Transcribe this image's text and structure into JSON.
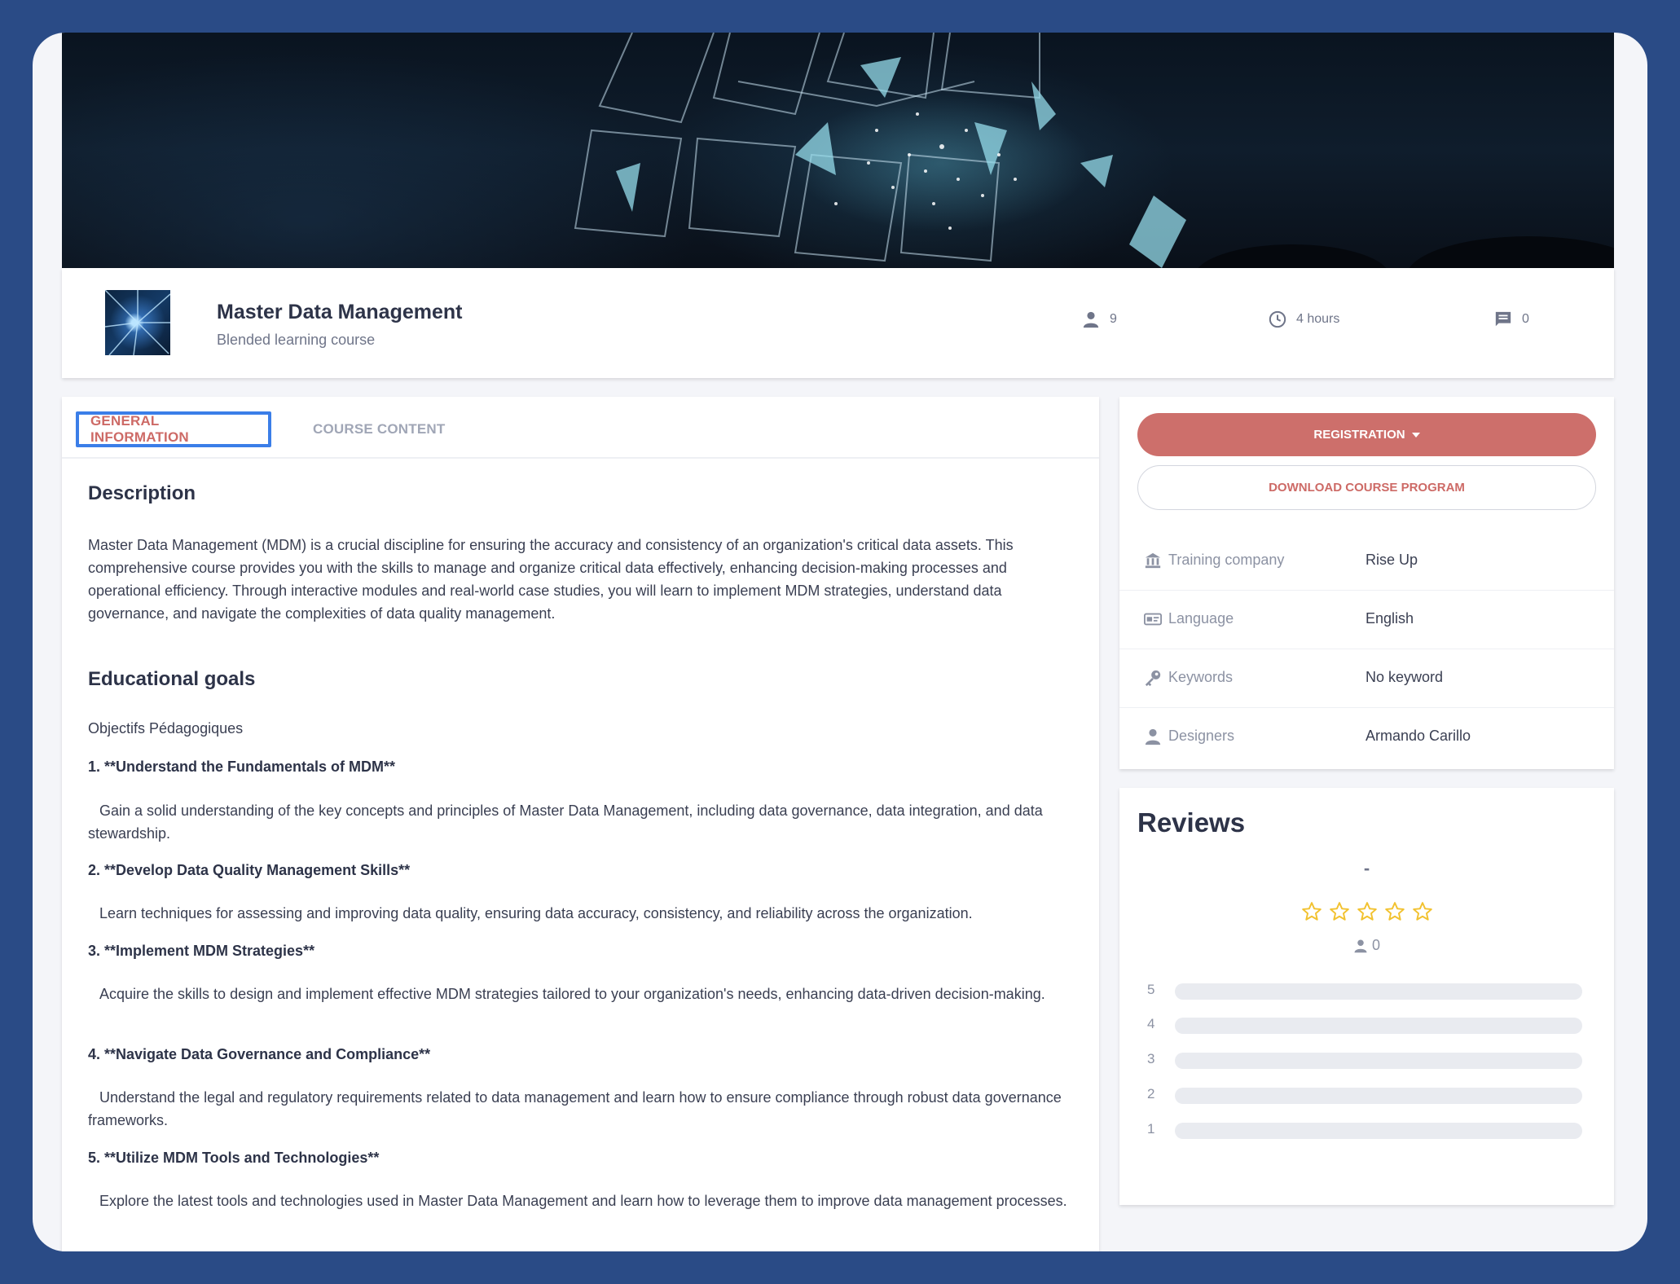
{
  "course": {
    "title": "Master Data Management",
    "subtitle": "Blended learning course",
    "participants": "9",
    "duration": "4 hours",
    "comments": "0"
  },
  "tabs": {
    "general": "GENERAL INFORMATION",
    "content": "COURSE CONTENT"
  },
  "description": {
    "heading": "Description",
    "text": "Master Data Management (MDM) is a crucial discipline for ensuring the accuracy and consistency of an organization's critical data assets. This comprehensive course provides you with the skills to manage and organize critical data effectively, enhancing decision-making processes and operational efficiency. Through interactive modules and real-world case studies, you will learn to implement MDM strategies, understand data governance, and navigate the complexities of data quality management."
  },
  "goals": {
    "heading": "Educational goals",
    "intro": "Objectifs Pédagogiques",
    "items": [
      {
        "title": "1. **Understand the Fundamentals of MDM**",
        "text": "Gain a solid understanding of the key concepts and principles of Master Data Management, including data governance, data integration, and data stewardship."
      },
      {
        "title": "2. **Develop Data Quality Management Skills**",
        "text": "Learn techniques for assessing and improving data quality, ensuring data accuracy, consistency, and reliability across the organization."
      },
      {
        "title": "3. **Implement MDM Strategies**",
        "text": "Acquire the skills to design and implement effective MDM strategies tailored to your organization's needs, enhancing data-driven decision-making."
      },
      {
        "title": "4. **Navigate Data Governance and Compliance**",
        "text": "Understand the legal and regulatory requirements related to data management and learn how to ensure compliance through robust data governance frameworks."
      },
      {
        "title": "5. **Utilize MDM Tools and Technologies**",
        "text": "Explore the latest tools and technologies used in Master Data Management and learn how to leverage them to improve data management processes."
      }
    ]
  },
  "actions": {
    "registration": "REGISTRATION",
    "download": "DOWNLOAD COURSE PROGRAM"
  },
  "info": [
    {
      "icon": "bank-icon",
      "label": "Training company",
      "value": "Rise Up"
    },
    {
      "icon": "id-card-icon",
      "label": "Language",
      "value": "English"
    },
    {
      "icon": "key-icon",
      "label": "Keywords",
      "value": "No keyword"
    },
    {
      "icon": "user-icon",
      "label": "Designers",
      "value": "Armando Carillo"
    }
  ],
  "reviews": {
    "heading": "Reviews",
    "average": "-",
    "count": "0",
    "rating_out_of": 5,
    "star_color": "#f2c230",
    "distribution": [
      {
        "stars": "5",
        "fraction": 0
      },
      {
        "stars": "4",
        "fraction": 0
      },
      {
        "stars": "3",
        "fraction": 0
      },
      {
        "stars": "2",
        "fraction": 0
      },
      {
        "stars": "1",
        "fraction": 0
      }
    ]
  },
  "colors": {
    "accent": "#cd6f6b",
    "focus": "#3b7ee8",
    "background": "#2a4b86"
  }
}
